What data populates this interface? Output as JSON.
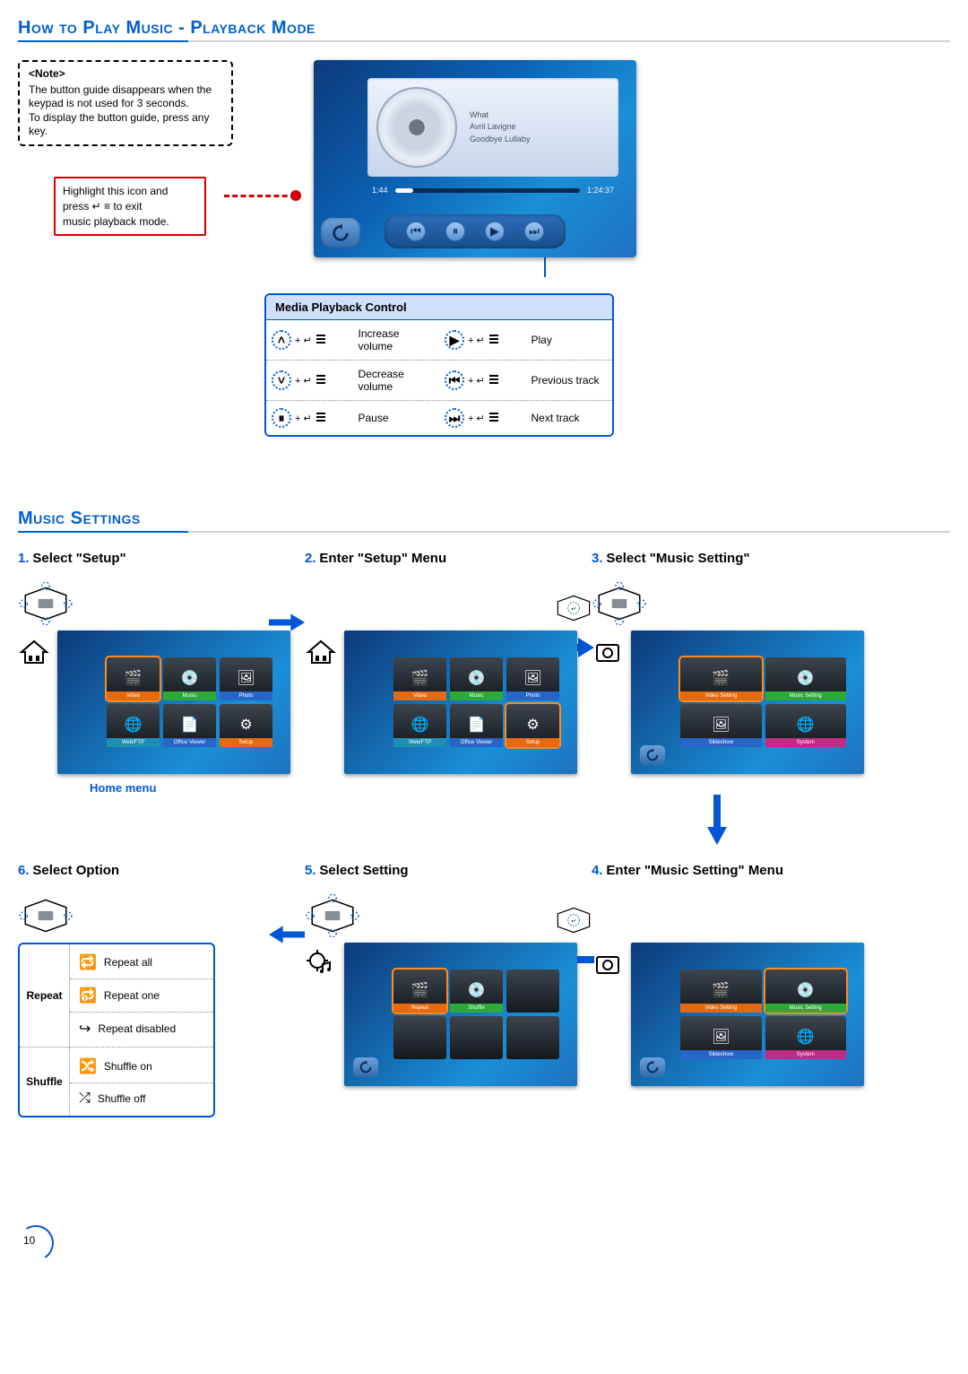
{
  "page": {
    "number": "10"
  },
  "section1": {
    "title": "How to Play Music - Playback Mode",
    "note": {
      "title": "<Note>",
      "body": "The button guide disappears when the keypad is not used for 3 seconds.\nTo display the button guide, press any key."
    },
    "exit_tip": {
      "l1": "Highlight this icon and",
      "l2": "press ↵ ≡ to exit",
      "l3": "music playback mode."
    },
    "player": {
      "track": {
        "title": "What",
        "artist": "Avril Lavigne",
        "album": "Goodbye Lullaby"
      },
      "elapsed": "1:44",
      "total": "1:24:37"
    },
    "media_table": {
      "header": "Media Playback Control",
      "rows": [
        {
          "l_icon": "˄",
          "l_label": "Increase volume",
          "r_icon": "▶",
          "r_label": "Play"
        },
        {
          "l_icon": "˅",
          "l_label": "Decrease volume",
          "r_icon": "⏮",
          "r_label": "Previous track"
        },
        {
          "l_icon": "⏸",
          "l_label": "Pause",
          "r_icon": "⏭",
          "r_label": "Next track"
        }
      ]
    }
  },
  "section2": {
    "title": "Music Settings",
    "steps": {
      "1": {
        "num": "1.",
        "title": "Select \"Setup\"",
        "caption": "Home menu",
        "tiles": [
          "Video",
          "Music",
          "Photo",
          "Web/FTP",
          "Office Viewer",
          "Setup"
        ],
        "selected_index": 0
      },
      "2": {
        "num": "2.",
        "title": "Enter \"Setup\" Menu",
        "tiles": [
          "Video",
          "Music",
          "Photo",
          "Web/FTP",
          "Office Viewer",
          "Setup"
        ],
        "selected_index": 5
      },
      "3": {
        "num": "3.",
        "title": "Select \"Music Setting\"",
        "tiles": [
          "Video Setting",
          "Music Setting",
          "Slideshow",
          "System"
        ],
        "selected_index": 0
      },
      "4": {
        "num": "4.",
        "title": "Enter \"Music Setting\" Menu",
        "tiles": [
          "Video Setting",
          "Music Setting",
          "Slideshow",
          "System"
        ],
        "selected_index": 1
      },
      "5": {
        "num": "5.",
        "title": "Select Setting",
        "tiles": [
          "Repeat",
          "Shuffle"
        ],
        "selected_index": 0
      },
      "6": {
        "num": "6.",
        "title": "Select Option",
        "table": {
          "repeat": {
            "label": "Repeat",
            "items": [
              "Repeat all",
              "Repeat one",
              "Repeat disabled"
            ]
          },
          "shuffle": {
            "label": "Shuffle",
            "items": [
              "Shuffle on",
              "Shuffle off"
            ]
          }
        }
      }
    }
  }
}
